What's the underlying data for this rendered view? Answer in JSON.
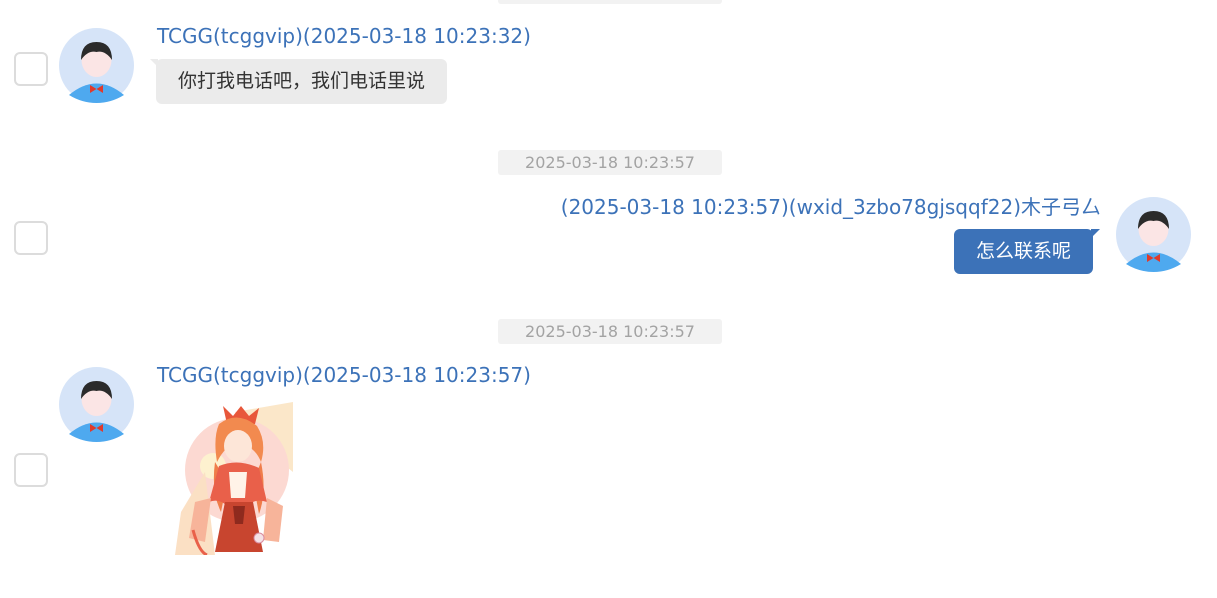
{
  "messages": [
    {
      "sender": "TCGG(tcggvip)(2025-03-18 10:23:32)",
      "text": "你打我电话吧，我们电话里说"
    },
    {
      "separator_time": "2025-03-18 10:23:57",
      "sender": "(2025-03-18 10:23:57)(wxid_3zbo78gjsqqf22)木子弓厶",
      "text": "怎么联系呢"
    },
    {
      "separator_time": "2025-03-18 10:23:57",
      "sender": "TCGG(tcggvip)(2025-03-18 10:23:57)",
      "image": "anime-girl-image"
    }
  ],
  "colors": {
    "link_blue": "#3c72b8",
    "bubble_gray": "#ebebeb",
    "pill_gray": "#f2f2f2"
  }
}
